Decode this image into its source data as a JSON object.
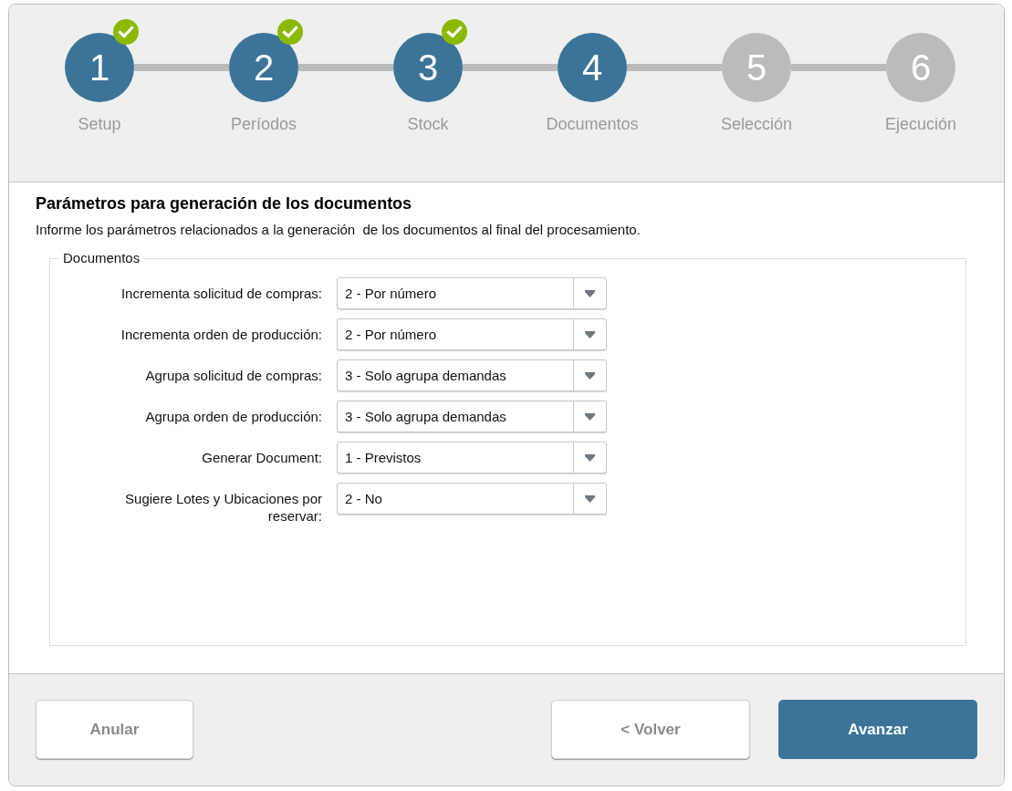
{
  "steps": [
    {
      "number": "1",
      "label": "Setup",
      "kind": "done"
    },
    {
      "number": "2",
      "label": "Períodos",
      "kind": "done"
    },
    {
      "number": "3",
      "label": "Stock",
      "kind": "done"
    },
    {
      "number": "4",
      "label": "Documentos",
      "kind": "current"
    },
    {
      "number": "5",
      "label": "Selección",
      "kind": "pending"
    },
    {
      "number": "6",
      "label": "Ejecución",
      "kind": "pending"
    }
  ],
  "section": {
    "title": "Parámetros para generación de los documentos",
    "description": "Informe los parámetros relacionados a la generación  de los documentos al final del procesamiento."
  },
  "fieldset": {
    "legend": "Documentos",
    "fields": [
      {
        "label": "Incrementa solicitud de compras:",
        "value": "2 - Por número"
      },
      {
        "label": "Incrementa orden de producción:",
        "value": "2 - Por número"
      },
      {
        "label": "Agrupa solicitud de compras:",
        "value": "3 - Solo agrupa demandas"
      },
      {
        "label": "Agrupa orden de producción:",
        "value": "3 - Solo agrupa demandas"
      },
      {
        "label": "Generar Document:",
        "value": "1 - Previstos"
      },
      {
        "label": "Sugiere Lotes y Ubicaciones por reservar:",
        "value": "2 - No"
      }
    ]
  },
  "footer": {
    "cancel_button": {
      "label": "Anular"
    },
    "nav_buttons": [
      {
        "label": "< Volver",
        "kind": "secondary"
      },
      {
        "label": "Avanzar",
        "kind": "primary"
      }
    ]
  }
}
